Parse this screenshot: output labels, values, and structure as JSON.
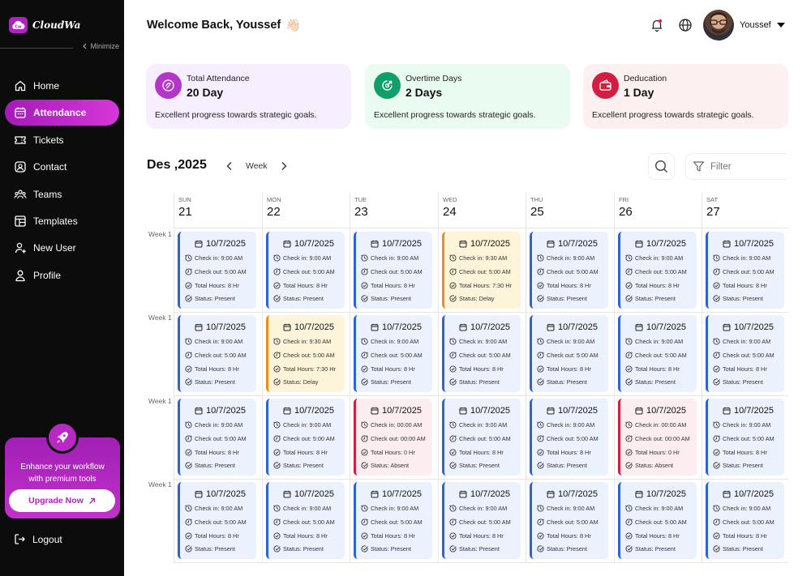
{
  "brand": {
    "name": "CloudWa",
    "badge": "Cw",
    "minimize_label": "Minimize"
  },
  "sidebar": {
    "items": [
      {
        "label": "Home",
        "icon": "home-icon",
        "active": false
      },
      {
        "label": "Attendance",
        "icon": "calendar-icon",
        "active": true
      },
      {
        "label": "Tickets",
        "icon": "ticket-icon",
        "active": false
      },
      {
        "label": "Contact",
        "icon": "contact-icon",
        "active": false
      },
      {
        "label": "Teams",
        "icon": "teams-icon",
        "active": false
      },
      {
        "label": "Templates",
        "icon": "templates-icon",
        "active": false
      },
      {
        "label": "New User",
        "icon": "new-user-icon",
        "active": false
      },
      {
        "label": "Profile",
        "icon": "profile-icon",
        "active": false
      }
    ],
    "upgrade": {
      "line1": "Enhance your workflow",
      "line2": "with premium tools",
      "button": "Upgrade Now"
    },
    "logout": "Logout"
  },
  "header": {
    "welcome": "Welcome Back, Youssef",
    "emoji": "👋🏻",
    "user_name": "Youssef"
  },
  "stats": [
    {
      "label": "Total Attendance",
      "value": "20 Day",
      "desc": "Excellent progress towards strategic goals.",
      "icon": "attendance-icon",
      "accent": "#b436c9",
      "bg": "#f7efff"
    },
    {
      "label": "Overtime Days",
      "value": "2 Days",
      "desc": "Excellent progress towards strategic goals.",
      "icon": "overtime-icon",
      "accent": "#0f9f6a",
      "bg": "#eafbf1"
    },
    {
      "label": "Deducation",
      "value": "1 Day",
      "desc": "Excellent progress towards strategic goals.",
      "icon": "deduction-icon",
      "accent": "#d21e40",
      "bg": "#fdf0f0"
    }
  ],
  "calendar": {
    "month": "Des ,2025",
    "view": "Week",
    "filter": "Filter",
    "days": [
      {
        "name": "SUN",
        "num": "21"
      },
      {
        "name": "MON",
        "num": "22"
      },
      {
        "name": "TUE",
        "num": "23"
      },
      {
        "name": "WED",
        "num": "24"
      },
      {
        "name": "THU",
        "num": "25"
      },
      {
        "name": "FRI",
        "num": "26"
      },
      {
        "name": "SAT",
        "num": "27"
      }
    ],
    "weeks": [
      "Week 1",
      "Week 1",
      "Week 1",
      "Week 1"
    ],
    "rows": [
      [
        {
          "date": "10/7/2025",
          "checkin": "Check in: 9:00 AM",
          "checkout": "Check out: 5:00 AM",
          "hours": "Total Hours: 8 Hr",
          "status": "Status: Present",
          "kind": "present"
        },
        {
          "date": "10/7/2025",
          "checkin": "Check in: 9:00 AM",
          "checkout": "Check out: 5:00 AM",
          "hours": "Total Hours: 8 Hr",
          "status": "Status: Present",
          "kind": "present"
        },
        {
          "date": "10/7/2025",
          "checkin": "Check in: 9:00 AM",
          "checkout": "Check out: 5:00 AM",
          "hours": "Total Hours: 8 Hr",
          "status": "Status: Present",
          "kind": "present"
        },
        {
          "date": "10/7/2025",
          "checkin": "Check in: 9:30 AM",
          "checkout": "Check out: 5:00 AM",
          "hours": "Total Hours: 7:30 Hr",
          "status": "Status: Delay",
          "kind": "delay"
        },
        {
          "date": "10/7/2025",
          "checkin": "Check in: 9:00 AM",
          "checkout": "Check out: 5:00 AM",
          "hours": "Total Hours: 8 Hr",
          "status": "Status: Present",
          "kind": "present"
        },
        {
          "date": "10/7/2025",
          "checkin": "Check in: 9:00 AM",
          "checkout": "Check out: 5:00 AM",
          "hours": "Total Hours: 8 Hr",
          "status": "Status: Present",
          "kind": "present"
        },
        {
          "date": "10/7/2025",
          "checkin": "Check in: 9:00 AM",
          "checkout": "Check out: 5:00 AM",
          "hours": "Total Hours: 8 Hr",
          "status": "Status: Present",
          "kind": "present"
        }
      ],
      [
        {
          "date": "10/7/2025",
          "checkin": "Check in: 9:00 AM",
          "checkout": "Check out: 5:00 AM",
          "hours": "Total Hours: 8 Hr",
          "status": "Status: Present",
          "kind": "present"
        },
        {
          "date": "10/7/2025",
          "checkin": "Check in: 9:30 AM",
          "checkout": "Check out: 5:00 AM",
          "hours": "Total Hours: 7:30 Hr",
          "status": "Status: Delay",
          "kind": "delay"
        },
        {
          "date": "10/7/2025",
          "checkin": "Check in: 9:00 AM",
          "checkout": "Check out: 5:00 AM",
          "hours": "Total Hours: 8 Hr",
          "status": "Status: Present",
          "kind": "present"
        },
        {
          "date": "10/7/2025",
          "checkin": "Check in: 9:00 AM",
          "checkout": "Check out: 5:00 AM",
          "hours": "Total Hours: 8 Hr",
          "status": "Status: Present",
          "kind": "present"
        },
        {
          "date": "10/7/2025",
          "checkin": "Check in: 9:00 AM",
          "checkout": "Check out: 5:00 AM",
          "hours": "Total Hours: 8 Hr",
          "status": "Status: Present",
          "kind": "present"
        },
        {
          "date": "10/7/2025",
          "checkin": "Check in: 9:00 AM",
          "checkout": "Check out: 5:00 AM",
          "hours": "Total Hours: 8 Hr",
          "status": "Status: Present",
          "kind": "present"
        },
        {
          "date": "10/7/2025",
          "checkin": "Check in: 9:00 AM",
          "checkout": "Check out: 5:00 AM",
          "hours": "Total Hours: 8 Hr",
          "status": "Status: Present",
          "kind": "present"
        }
      ],
      [
        {
          "date": "10/7/2025",
          "checkin": "Check in: 9:00 AM",
          "checkout": "Check out: 5:00 AM",
          "hours": "Total Hours: 8 Hr",
          "status": "Status: Present",
          "kind": "present"
        },
        {
          "date": "10/7/2025",
          "checkin": "Check in: 9:00 AM",
          "checkout": "Check out: 5:00 AM",
          "hours": "Total Hours: 8 Hr",
          "status": "Status: Present",
          "kind": "present"
        },
        {
          "date": "10/7/2025",
          "checkin": "Check in: 00:00 AM",
          "checkout": "Check out: 00:00 AM",
          "hours": "Total Hours: 0 Hr",
          "status": "Status: Absent",
          "kind": "absent"
        },
        {
          "date": "10/7/2025",
          "checkin": "Check in: 9:00 AM",
          "checkout": "Check out: 5:00 AM",
          "hours": "Total Hours: 8 Hr",
          "status": "Status: Present",
          "kind": "present"
        },
        {
          "date": "10/7/2025",
          "checkin": "Check in: 9:00 AM",
          "checkout": "Check out: 5:00 AM",
          "hours": "Total Hours: 8 Hr",
          "status": "Status: Present",
          "kind": "present"
        },
        {
          "date": "10/7/2025",
          "checkin": "Check in: 00:00 AM",
          "checkout": "Check out: 00:00 AM",
          "hours": "Total Hours: 0 Hr",
          "status": "Status: Absent",
          "kind": "absent"
        },
        {
          "date": "10/7/2025",
          "checkin": "Check in: 9:00 AM",
          "checkout": "Check out: 5:00 AM",
          "hours": "Total Hours: 8 Hr",
          "status": "Status: Present",
          "kind": "present"
        }
      ],
      [
        {
          "date": "10/7/2025",
          "checkin": "Check in: 9:00 AM",
          "checkout": "Check out: 5:00 AM",
          "hours": "Total Hours: 8 Hr",
          "status": "Status: Present",
          "kind": "present"
        },
        {
          "date": "10/7/2025",
          "checkin": "Check in: 9:00 AM",
          "checkout": "Check out: 5:00 AM",
          "hours": "Total Hours: 8 Hr",
          "status": "Status: Present",
          "kind": "present"
        },
        {
          "date": "10/7/2025",
          "checkin": "Check in: 9:00 AM",
          "checkout": "Check out: 5:00 AM",
          "hours": "Total Hours: 8 Hr",
          "status": "Status: Present",
          "kind": "present"
        },
        {
          "date": "10/7/2025",
          "checkin": "Check in: 9:00 AM",
          "checkout": "Check out: 5:00 AM",
          "hours": "Total Hours: 8 Hr",
          "status": "Status: Present",
          "kind": "present"
        },
        {
          "date": "10/7/2025",
          "checkin": "Check in: 9:00 AM",
          "checkout": "Check out: 5:00 AM",
          "hours": "Total Hours: 8 Hr",
          "status": "Status: Present",
          "kind": "present"
        },
        {
          "date": "10/7/2025",
          "checkin": "Check in: 9:00 AM",
          "checkout": "Check out: 5:00 AM",
          "hours": "Total Hours: 8 Hr",
          "status": "Status: Present",
          "kind": "present"
        },
        {
          "date": "10/7/2025",
          "checkin": "Check in: 9:00 AM",
          "checkout": "Check out: 5:00 AM",
          "hours": "Total Hours: 8 Hr",
          "status": "Status: Present",
          "kind": "present"
        }
      ]
    ]
  }
}
